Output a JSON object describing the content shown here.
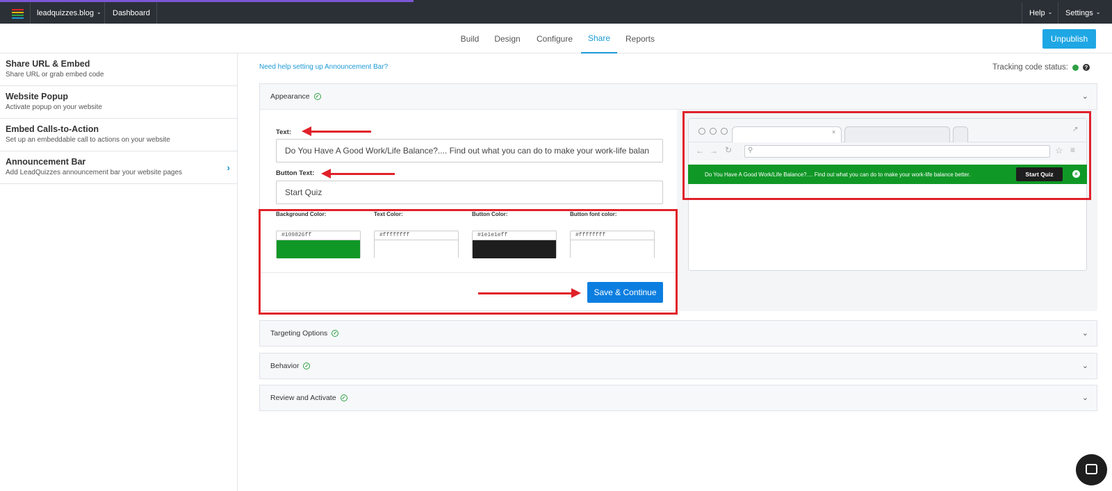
{
  "topbar": {
    "site": "leadquizzes.blog",
    "dashboard": "Dashboard",
    "help": "Help",
    "settings": "Settings",
    "logo_colors": [
      "#e0212a",
      "#f2b705",
      "#2ea043",
      "#1b9ad6"
    ]
  },
  "nav": {
    "tabs": [
      "Build",
      "Design",
      "Configure",
      "Share",
      "Reports"
    ],
    "active_tab": "Share",
    "unpublish": "Unpublish"
  },
  "sidebar": {
    "items": [
      {
        "title": "Share URL & Embed",
        "subtitle": "Share URL or grab embed code"
      },
      {
        "title": "Website Popup",
        "subtitle": "Activate popup on your website"
      },
      {
        "title": "Embed Calls-to-Action",
        "subtitle": "Set up an embeddable call to actions on your website"
      },
      {
        "title": "Announcement Bar",
        "subtitle": "Add LeadQuizzes announcement bar your website pages"
      }
    ]
  },
  "main": {
    "help_link": "Need help setting up Announcement Bar?",
    "tracking_label": "Tracking code status:",
    "panels": {
      "appearance": "Appearance",
      "targeting": "Targeting Options",
      "behavior": "Behavior",
      "review": "Review and Activate"
    },
    "form": {
      "text_label": "Text:",
      "text_value": "Do You Have A Good Work/Life Balance?.... Find out what you can do to make your work-life balan",
      "button_text_label": "Button Text:",
      "button_text_value": "Start Quiz",
      "colors": [
        {
          "label": "Background Color:",
          "hex": "#109826ff",
          "swatch": "#109826"
        },
        {
          "label": "Text Color:",
          "hex": "#ffffffff",
          "swatch": "#ffffff"
        },
        {
          "label": "Button Color:",
          "hex": "#1e1e1eff",
          "swatch": "#1e1e1e"
        },
        {
          "label": "Button font color:",
          "hex": "#ffffffff",
          "swatch": "#ffffff"
        }
      ],
      "save": "Save & Continue"
    },
    "preview": {
      "bar_text": "Do You Have A Good Work/Life Balance?.... Find out what you can do to make your work-life balance better.",
      "button": "Start Quiz",
      "bar_color": "#109826"
    }
  },
  "colors": {
    "accent": "#1b9ad6",
    "annotation_red": "#e0212a",
    "topbar": "#2b3036"
  }
}
